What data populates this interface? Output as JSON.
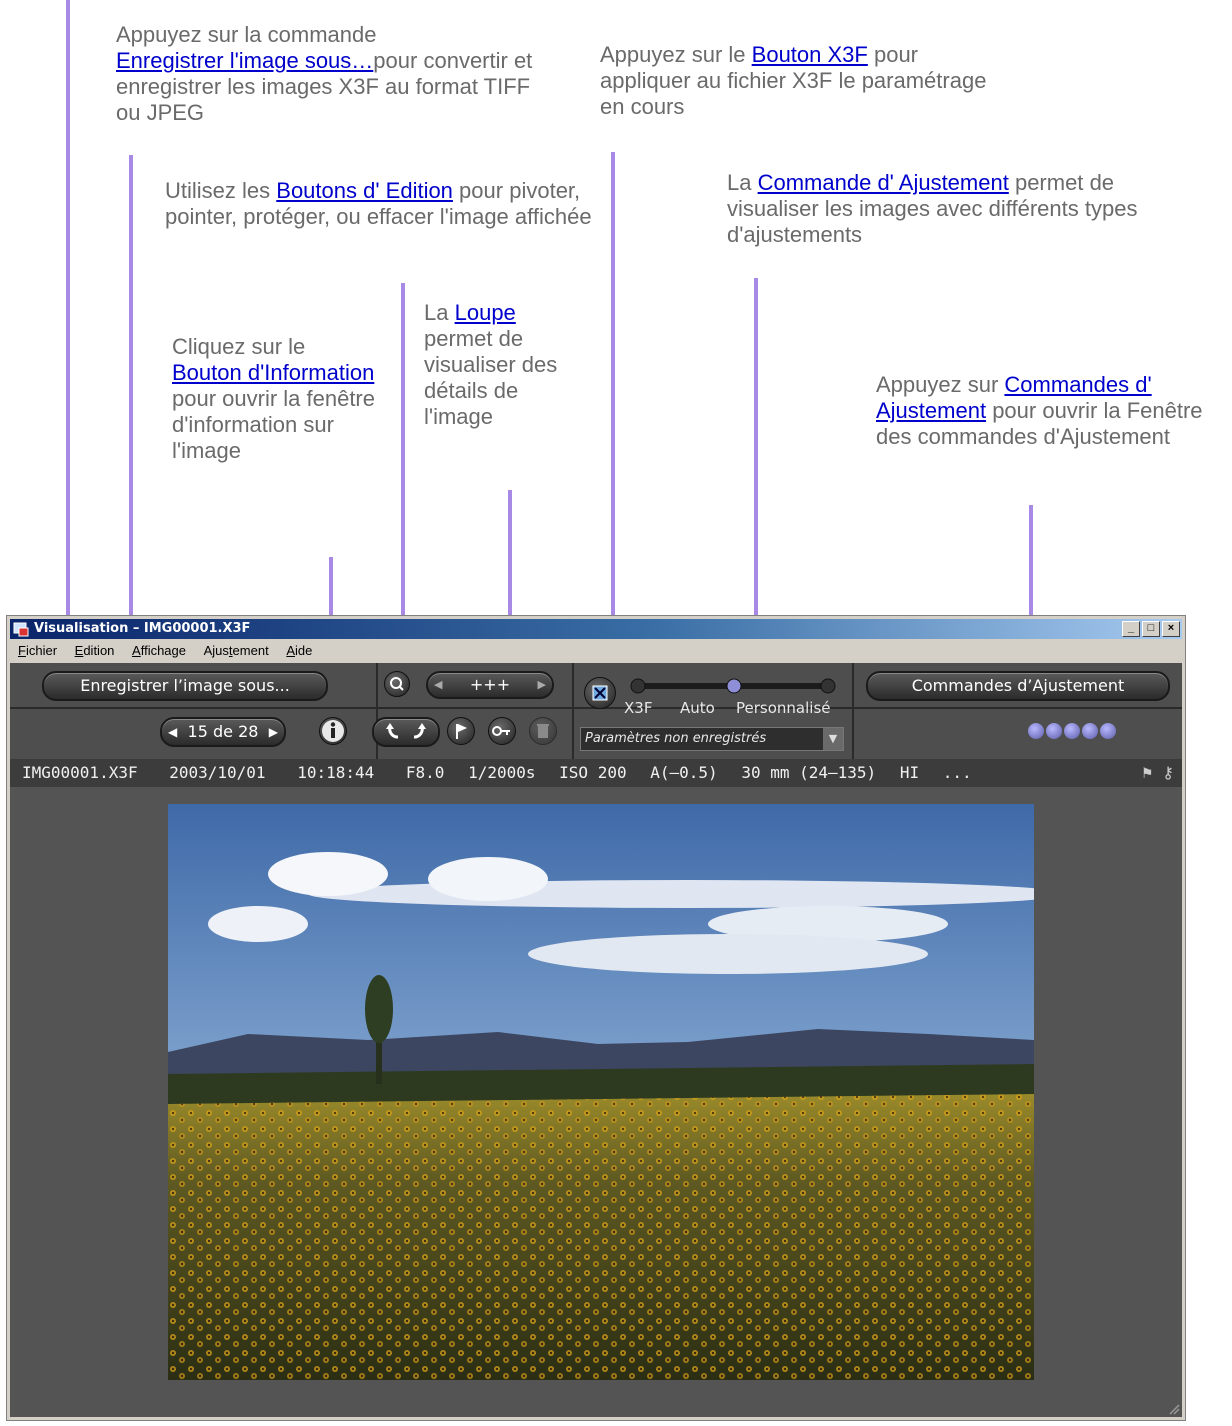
{
  "annotations": {
    "save": {
      "prefix": "Appuyez sur la commande",
      "link": "Enregistrer l'image sous…",
      "suffix_inline": "pour",
      "rest": "convertir et enregistrer les images X3F au format TIFF ou JPEG"
    },
    "edit": {
      "prefix": "Utilisez les",
      "link": "Boutons d' Edition",
      "suffix_inline": "pour",
      "rest": "pivoter, pointer, protéger, ou effacer l'image affichée"
    },
    "info": {
      "prefix": "Cliquez sur le",
      "link": "Bouton d'Information",
      "rest": "pour ouvrir la fenêtre d'information sur l'image"
    },
    "loupe": {
      "prefix": "La",
      "link": "Loupe",
      "rest": "permet de visualiser des détails de l'image"
    },
    "x3f": {
      "prefix": "Appuyez sur le",
      "link": "Bouton X3F",
      "suffix_inline": "pour",
      "rest": "appliquer au fichier X3F le paramétrage en cours"
    },
    "adjust": {
      "prefix": "La",
      "link": "Commande d' Ajustement",
      "suffix_inline": "permet",
      "rest": "de visualiser les images avec différents types d'ajustements"
    },
    "controls": {
      "prefix": "Appuyez sur",
      "link": "Commandes d' Ajustement",
      "rest": "pour ouvrir la Fenêtre des commandes d'Ajustement"
    }
  },
  "window": {
    "title": "Visualisation – IMG00001.X3F",
    "controls": [
      "_",
      "□",
      "×"
    ],
    "menu": [
      {
        "first": "F",
        "rest": "ichier"
      },
      {
        "first": "E",
        "rest": "dition"
      },
      {
        "first": "A",
        "rest": "ffichage"
      },
      {
        "first": "Ajus",
        "u": "t",
        "rest2": "ement"
      },
      {
        "first": "A",
        "rest": "ide"
      }
    ]
  },
  "menu_labels": [
    "Fichier",
    "Edition",
    "Affichage",
    "Ajustement",
    "Aide"
  ],
  "toolbar": {
    "save_as": "Enregistrer l’image sous...",
    "counter": "15 de 28",
    "zoom_level": "+++",
    "slider_labels": [
      "X3F",
      "Auto",
      "Personnalisé"
    ],
    "slider_position": "Auto",
    "settings_select": "Paramètres non enregistrés",
    "adjust_controls": "Commandes d’Ajustement"
  },
  "info_bar": {
    "filename": "IMG00001.X3F",
    "date": "2003/10/01",
    "time": "10:18:44",
    "aperture": "F8.0",
    "shutter": "1/2000s",
    "iso": "ISO 200",
    "mode": "A(–0.5)",
    "focal": "30 mm (24–135)",
    "quality": "HI",
    "more": "..."
  },
  "colors": {
    "accent_arrow": "#a889e6",
    "link": "#0000cc",
    "note_text": "#6a6a6a"
  }
}
